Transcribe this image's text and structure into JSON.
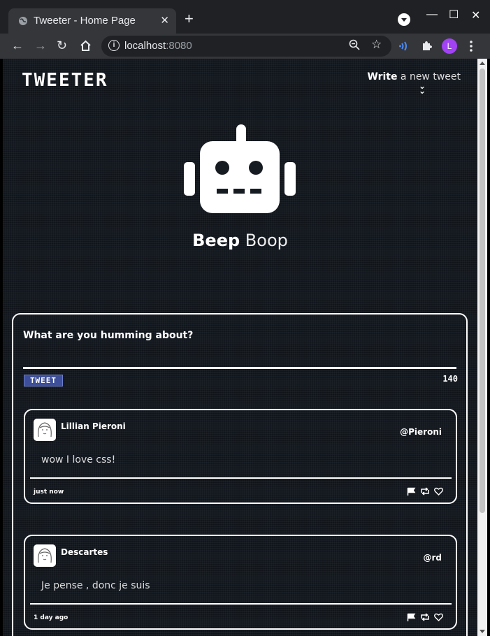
{
  "browser": {
    "tab_title": "Tweeter - Home Page",
    "tab_close": "✕",
    "new_tab": "+",
    "url_host": "localhost",
    "url_port": ":8080",
    "profile_initial": "L",
    "window": {
      "minimize": "—",
      "maximize": "☐",
      "close": "✕"
    },
    "nav": {
      "back": "←",
      "forward": "→",
      "reload": "↻"
    }
  },
  "header": {
    "brand": "TWEETER",
    "write_bold": "Write",
    "write_rest": " a new tweet"
  },
  "profile": {
    "first_name": "Beep",
    "last_name": "Boop"
  },
  "composer": {
    "prompt": "What are you humming about?",
    "button_label": "TWEET",
    "counter": "140"
  },
  "tweets": [
    {
      "name": "Lillian Pieroni",
      "handle": "@Pieroni",
      "text": "wow I love css!",
      "time": "just now"
    },
    {
      "name": "Descartes",
      "handle": "@rd",
      "text": "Je pense , donc je suis",
      "time": "1 day ago"
    }
  ]
}
